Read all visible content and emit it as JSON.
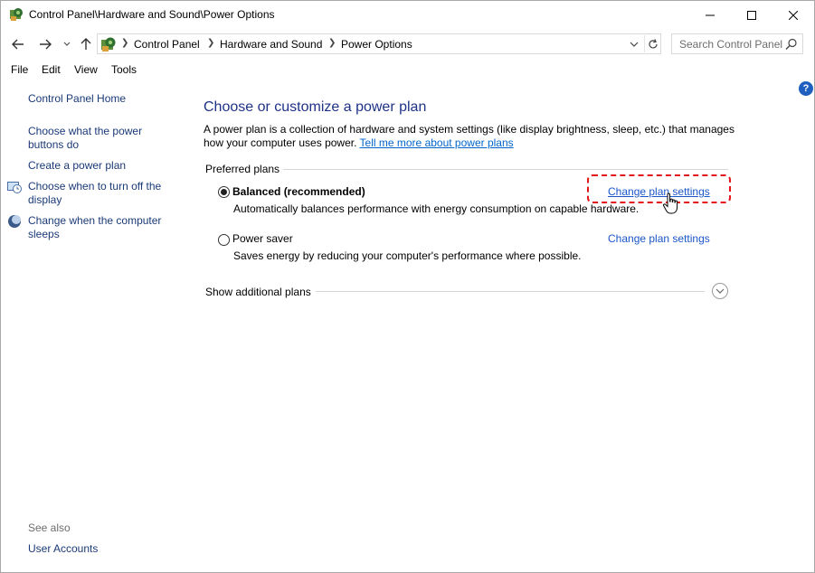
{
  "window": {
    "title": "Control Panel\\Hardware and Sound\\Power Options",
    "icon": "control-panel-icon"
  },
  "address_bar": {
    "crumbs": [
      "Control Panel",
      "Hardware and Sound",
      "Power Options"
    ],
    "search_placeholder": "Search Control Panel"
  },
  "menu": {
    "items": [
      "File",
      "Edit",
      "View",
      "Tools"
    ]
  },
  "sidebar": {
    "home": "Control Panel Home",
    "tasks": [
      "Choose what the power buttons do",
      "Create a power plan",
      "Choose when to turn off the display",
      "Change when the computer sleeps"
    ],
    "see_also_label": "See also",
    "see_also": [
      "User Accounts"
    ]
  },
  "main": {
    "title": "Choose or customize a power plan",
    "description": "A power plan is a collection of hardware and system settings (like display brightness, sleep, etc.) that manages how your computer uses power.",
    "learn_more": "Tell me more about power plans",
    "group_label": "Preferred plans",
    "plans": [
      {
        "name": "Balanced (recommended)",
        "description": "Automatically balances performance with energy consumption on capable hardware.",
        "link": "Change plan settings",
        "selected": true
      },
      {
        "name": "Power saver",
        "description": "Saves energy by reducing your computer's performance where possible.",
        "link": "Change plan settings",
        "selected": false
      }
    ],
    "show_additional": "Show additional plans"
  },
  "help_label": "?",
  "colors": {
    "title_blue": "#1e3287",
    "link_blue": "#1a56c9",
    "highlight_red": "#e3151a"
  }
}
